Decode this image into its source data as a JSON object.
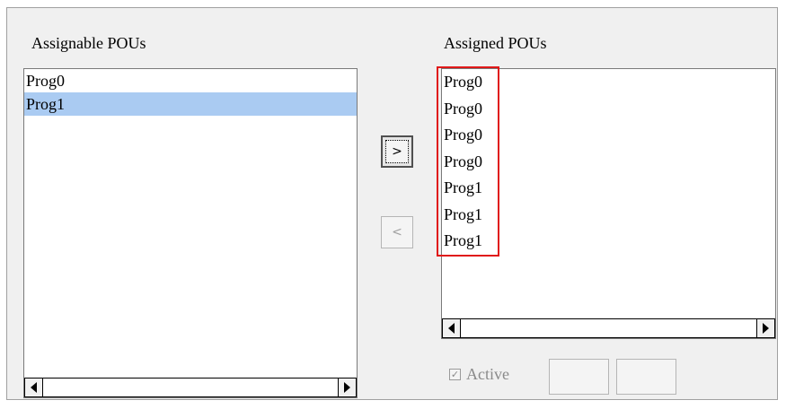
{
  "left": {
    "title": "Assignable POUs",
    "items": [
      {
        "label": "Prog0",
        "selected": false
      },
      {
        "label": "Prog1",
        "selected": true
      }
    ]
  },
  "right": {
    "title": "Assigned POUs",
    "items": [
      "Prog0",
      "Prog0",
      "Prog0",
      "Prog0",
      "Prog1",
      "Prog1",
      "Prog1"
    ]
  },
  "buttons": {
    "add_label": ">",
    "remove_label": "<"
  },
  "active_checkbox": {
    "label": "Active",
    "checked": true
  },
  "colors": {
    "selection": "#aacbf2",
    "highlight_border": "#e01818"
  }
}
